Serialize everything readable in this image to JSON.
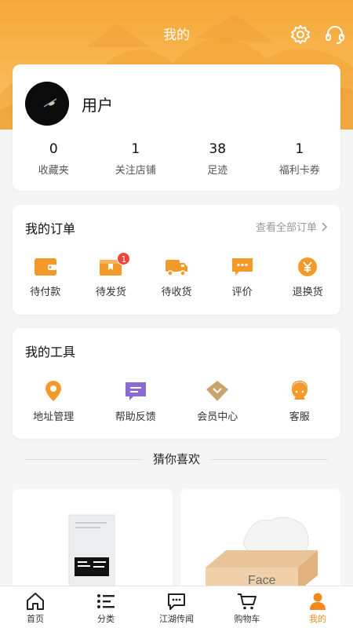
{
  "header": {
    "title": "我的"
  },
  "profile": {
    "username": "用户"
  },
  "stats": [
    {
      "value": "0",
      "label": "收藏夹"
    },
    {
      "value": "1",
      "label": "关注店铺"
    },
    {
      "value": "38",
      "label": "足迹"
    },
    {
      "value": "1",
      "label": "福利卡券"
    }
  ],
  "orders": {
    "title": "我的订单",
    "view_all": "查看全部订单",
    "items": [
      {
        "label": "待付款",
        "icon": "wallet-icon"
      },
      {
        "label": "待发货",
        "icon": "package-icon",
        "badge": "1"
      },
      {
        "label": "待收货",
        "icon": "truck-icon"
      },
      {
        "label": "评价",
        "icon": "comment-icon"
      },
      {
        "label": "退换货",
        "icon": "yuan-icon"
      }
    ]
  },
  "tools": {
    "title": "我的工具",
    "items": [
      {
        "label": "地址管理",
        "icon": "location-icon"
      },
      {
        "label": "帮助反馈",
        "icon": "feedback-icon"
      },
      {
        "label": "会员中心",
        "icon": "member-icon"
      },
      {
        "label": "客服",
        "icon": "customer-service-icon"
      }
    ]
  },
  "recommend": {
    "title": "猜你喜欢",
    "product_2_brand": "Face"
  },
  "tabbar": [
    {
      "label": "首页",
      "icon": "home-icon"
    },
    {
      "label": "分类",
      "icon": "category-icon"
    },
    {
      "label": "江湖传闻",
      "icon": "chat-icon"
    },
    {
      "label": "购物车",
      "icon": "cart-icon"
    },
    {
      "label": "我的",
      "icon": "profile-icon",
      "active": true
    }
  ],
  "colors": {
    "accent": "#f5a93a",
    "icon_orange": "#f39a2b",
    "icon_purple": "#8a6bd6",
    "icon_tan": "#c9a56d",
    "badge": "#f0443b",
    "active_tab": "#f08a1c"
  }
}
